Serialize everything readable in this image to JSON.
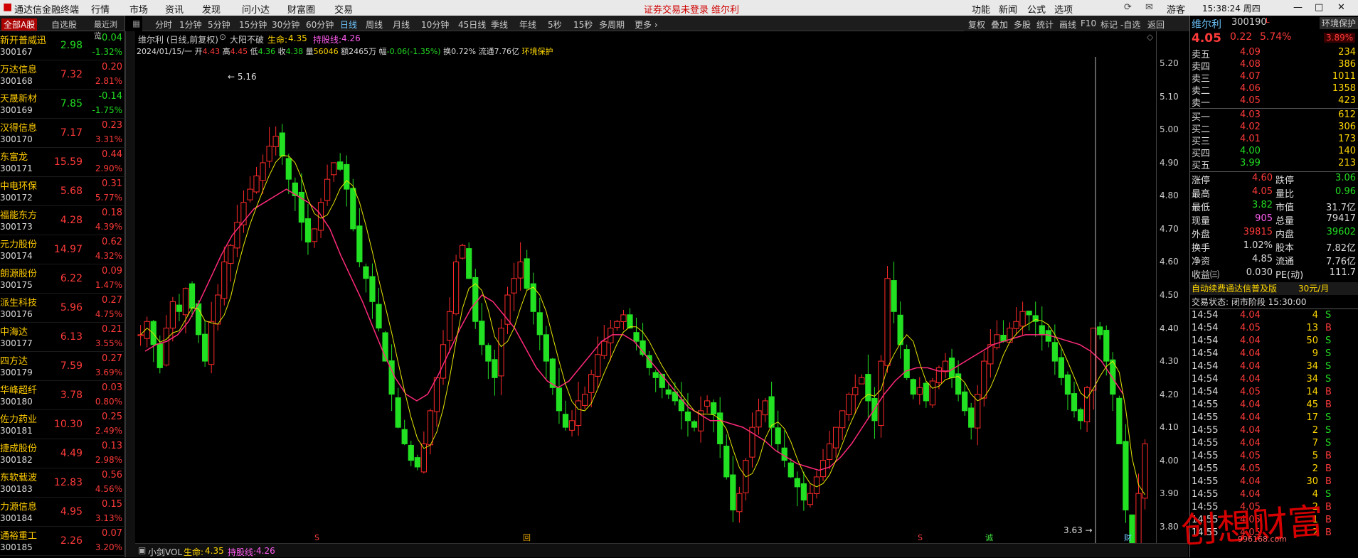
{
  "menu": {
    "app_title": "通达信金融终端",
    "items": [
      "行情",
      "市场",
      "资讯",
      "发现",
      "问小达",
      "财富圈",
      "交易"
    ],
    "login_warning": "证券交易未登录",
    "stock_name": "维尔利",
    "right_items": [
      "功能",
      "新闻",
      "公式",
      "选项"
    ],
    "guest": "游客",
    "clock": "15:38:24 周四"
  },
  "left": {
    "tabs": [
      "全部A股",
      "自选股",
      "最近浏览"
    ],
    "rows": [
      {
        "name": "新开普威迅",
        "code": "300167",
        "price": "2.98",
        "chg": "-0.04",
        "pct": "-1.32%",
        "dir": "dn"
      },
      {
        "name": "万达信息",
        "code": "300168",
        "price": "7.32",
        "chg": "0.20",
        "pct": "2.81%",
        "dir": "up"
      },
      {
        "name": "天晟新材",
        "code": "300169",
        "price": "7.85",
        "chg": "-0.14",
        "pct": "-1.75%",
        "dir": "dn"
      },
      {
        "name": "汉得信息",
        "code": "300170",
        "price": "7.17",
        "chg": "0.23",
        "pct": "3.31%",
        "dir": "up"
      },
      {
        "name": "东富龙",
        "code": "300171",
        "price": "15.59",
        "chg": "0.44",
        "pct": "2.90%",
        "dir": "up"
      },
      {
        "name": "中电环保",
        "code": "300172",
        "price": "5.68",
        "chg": "0.31",
        "pct": "5.77%",
        "dir": "up"
      },
      {
        "name": "福能东方",
        "code": "300173",
        "price": "4.28",
        "chg": "0.18",
        "pct": "4.39%",
        "dir": "up"
      },
      {
        "name": "元力股份",
        "code": "300174",
        "price": "14.97",
        "chg": "0.62",
        "pct": "4.32%",
        "dir": "up"
      },
      {
        "name": "朗源股份",
        "code": "300175",
        "price": "6.22",
        "chg": "0.09",
        "pct": "1.47%",
        "dir": "up"
      },
      {
        "name": "派生科技",
        "code": "300176",
        "price": "5.96",
        "chg": "0.27",
        "pct": "4.75%",
        "dir": "up"
      },
      {
        "name": "中海达",
        "code": "300177",
        "price": "6.13",
        "chg": "0.21",
        "pct": "3.55%",
        "dir": "up"
      },
      {
        "name": "四方达",
        "code": "300179",
        "price": "7.59",
        "chg": "0.27",
        "pct": "3.69%",
        "dir": "up"
      },
      {
        "name": "华峰超纤",
        "code": "300180",
        "price": "3.78",
        "chg": "0.03",
        "pct": "0.80%",
        "dir": "up"
      },
      {
        "name": "佐力药业",
        "code": "300181",
        "price": "10.30",
        "chg": "0.25",
        "pct": "2.49%",
        "dir": "up"
      },
      {
        "name": "捷成股份",
        "code": "300182",
        "price": "4.49",
        "chg": "0.13",
        "pct": "2.98%",
        "dir": "up"
      },
      {
        "name": "东软载波",
        "code": "300183",
        "price": "12.83",
        "chg": "0.56",
        "pct": "4.56%",
        "dir": "up"
      },
      {
        "name": "力源信息",
        "code": "300184",
        "price": "4.95",
        "chg": "0.15",
        "pct": "3.13%",
        "dir": "up"
      },
      {
        "name": "通裕重工",
        "code": "300185",
        "price": "2.26",
        "chg": "0.07",
        "pct": "3.20%",
        "dir": "up"
      }
    ]
  },
  "period": {
    "items": [
      "分时",
      "1分钟",
      "5分钟",
      "15分钟",
      "30分钟",
      "60分钟",
      "日线",
      "周线",
      "月线",
      "10分钟",
      "45日线",
      "季线",
      "年线",
      "5秒",
      "15秒",
      "多周期",
      "更多 ›"
    ],
    "selected": "日线"
  },
  "toolbar": {
    "items": [
      "复权",
      "叠加",
      "多股",
      "统计",
      "画线",
      "F10",
      "标记",
      "-自选",
      "返回"
    ]
  },
  "chart": {
    "title": "维尔利 (日线,前复权)",
    "indicator": "大阳不破",
    "life_label": "生命:",
    "life_value": "4.35",
    "hold_label": "持股线:",
    "hold_value": "4.26",
    "date": "2024/01/15/一",
    "open_l": "开",
    "open": "4.43",
    "high_l": "高",
    "high": "4.45",
    "low_l": "低",
    "low": "4.36",
    "close_l": "收",
    "close": "4.38",
    "vol_l": "量",
    "vol": "56046",
    "amt_l": "额",
    "amt": "2465万",
    "amp_l": "幅",
    "amp": "-0.06(-1.35%)",
    "turn_l": "换",
    "turn": "0.72%",
    "flow_l": "流通",
    "flow": "7.76亿",
    "tag": "环境保护",
    "max_label": "5.16",
    "min_label": "3.63",
    "y_ticks": [
      "5.20",
      "5.10",
      "5.00",
      "4.90",
      "4.80",
      "4.70",
      "4.60",
      "4.50",
      "4.40",
      "4.30",
      "4.20",
      "4.10",
      "4.00",
      "3.90",
      "3.80"
    ],
    "markers": [
      "S",
      "回",
      "S",
      "诚",
      "财"
    ]
  },
  "vol": {
    "name": "小剑VOL",
    "life_label": "生命:",
    "life_value": "4.35",
    "hold_label": "持股线:",
    "hold_value": "4.26"
  },
  "chart_data": {
    "type": "candlestick",
    "title": "维尔利 (日线,前复权)",
    "ylim": [
      3.75,
      5.22
    ],
    "ticks": [
      5.2,
      5.1,
      5.0,
      4.9,
      4.8,
      4.7,
      4.6,
      4.5,
      4.4,
      4.3,
      4.2,
      4.1,
      4.0,
      3.9,
      3.8
    ],
    "max": 5.16,
    "min": 3.63,
    "close_path": [
      4.38,
      4.42,
      4.35,
      4.28,
      4.4,
      4.48,
      4.45,
      4.52,
      4.46,
      4.38,
      4.3,
      4.42,
      4.5,
      4.6,
      4.65,
      4.72,
      4.78,
      4.82,
      4.86,
      4.9,
      4.95,
      4.98,
      4.92,
      4.85,
      4.8,
      4.72,
      4.66,
      4.7,
      4.78,
      4.85,
      4.9,
      4.88,
      4.82,
      4.7,
      4.6,
      4.55,
      4.48,
      4.4,
      4.3,
      4.2,
      4.1,
      4.05,
      4.0,
      3.98,
      4.05,
      4.15,
      4.25,
      4.35,
      4.45,
      4.6,
      4.65,
      4.55,
      4.42,
      4.35,
      4.3,
      4.25,
      4.4,
      4.5,
      4.55,
      4.6,
      4.52,
      4.45,
      4.38,
      4.3,
      4.22,
      4.15,
      4.1,
      4.12,
      4.18,
      4.2,
      4.26,
      4.32,
      4.36,
      4.4,
      4.42,
      4.44,
      4.4,
      4.36,
      4.32,
      4.28,
      4.25,
      4.22,
      4.2,
      4.18,
      4.15,
      4.12,
      4.1,
      4.15,
      4.18,
      4.14,
      4.05,
      3.95,
      3.85,
      3.9,
      4.0,
      4.1,
      4.15,
      4.18,
      4.1,
      4.05,
      4.0,
      3.95,
      3.92,
      3.88,
      3.9,
      3.95,
      4.0,
      4.05,
      4.1,
      4.15,
      4.2,
      4.22,
      4.25,
      4.18,
      4.12,
      4.3,
      4.55,
      4.45,
      4.35,
      4.25,
      4.2,
      4.22,
      4.18,
      4.24,
      4.28,
      4.3,
      4.25,
      4.2,
      4.15,
      4.1,
      4.2,
      4.3,
      4.35,
      4.38,
      4.36,
      4.4,
      4.42,
      4.45,
      4.44,
      4.42,
      4.38,
      4.36,
      4.3,
      4.25,
      4.2,
      4.15,
      4.12,
      4.22,
      4.4,
      4.38,
      4.3,
      4.2,
      4.05,
      3.85,
      3.63,
      3.9,
      4.05
    ],
    "ma_path": [
      4.33,
      4.35,
      4.36,
      4.38,
      4.42,
      4.48,
      4.55,
      4.62,
      4.68,
      4.72,
      4.76,
      4.78,
      4.8,
      4.82,
      4.8,
      4.78,
      4.75,
      4.7,
      4.62,
      4.55,
      4.48,
      4.4,
      4.32,
      4.25,
      4.2,
      4.18,
      4.2,
      4.26,
      4.33,
      4.4,
      4.46,
      4.5,
      4.48,
      4.44,
      4.4,
      4.34,
      4.28,
      4.24,
      4.22,
      4.24,
      4.28,
      4.32,
      4.36,
      4.38,
      4.38,
      4.36,
      4.32,
      4.28,
      4.24,
      4.2,
      4.16,
      4.14,
      4.12,
      4.12,
      4.11,
      4.1,
      4.08,
      4.06,
      4.03,
      4.01,
      3.99,
      3.98,
      3.97,
      3.98,
      4.01,
      4.05,
      4.1,
      4.15,
      4.2,
      4.24,
      4.27,
      4.28,
      4.28,
      4.27,
      4.27,
      4.29,
      4.31,
      4.33,
      4.35,
      4.36,
      4.37,
      4.38,
      4.38,
      4.38,
      4.37,
      4.36,
      4.35,
      4.33,
      4.3,
      4.25,
      4.2
    ]
  },
  "quote": {
    "name": "维尔利",
    "code": "300190",
    "flag": "L",
    "tag": "环境保护",
    "price": "4.05",
    "chg": "0.22",
    "pct": "5.74%",
    "weibi": "3.89%",
    "asks": [
      {
        "l": "卖五",
        "p": "4.09",
        "v": "234"
      },
      {
        "l": "卖四",
        "p": "4.08",
        "v": "386"
      },
      {
        "l": "卖三",
        "p": "4.07",
        "v": "1011"
      },
      {
        "l": "卖二",
        "p": "4.06",
        "v": "1358"
      },
      {
        "l": "卖一",
        "p": "4.05",
        "v": "423"
      }
    ],
    "bids": [
      {
        "l": "买一",
        "p": "4.03",
        "v": "612"
      },
      {
        "l": "买二",
        "p": "4.02",
        "v": "306"
      },
      {
        "l": "买三",
        "p": "4.01",
        "v": "173"
      },
      {
        "l": "买四",
        "p": "4.00",
        "v": "140"
      },
      {
        "l": "买五",
        "p": "3.99",
        "v": "213"
      }
    ],
    "stats": [
      {
        "a": "涨停",
        "b": "4.60",
        "bc": "up",
        "c": "跌停",
        "d": "3.06",
        "dc": "dn"
      },
      {
        "a": "最高",
        "b": "4.05",
        "bc": "up",
        "c": "量比",
        "d": "0.96",
        "dc": "dn"
      },
      {
        "a": "最低",
        "b": "3.82",
        "bc": "dn",
        "c": "市值",
        "d": "31.7亿",
        "dc": "wh"
      },
      {
        "a": "现量",
        "b": "905",
        "bc": "pk",
        "c": "总量",
        "d": "79417",
        "dc": "wh"
      },
      {
        "a": "外盘",
        "b": "39815",
        "bc": "up",
        "c": "内盘",
        "d": "39602",
        "dc": "dn"
      },
      {
        "a": "换手",
        "b": "1.02%",
        "bc": "wh",
        "c": "股本",
        "d": "7.82亿",
        "dc": "wh"
      },
      {
        "a": "净资",
        "b": "4.85",
        "bc": "wh",
        "c": "流通",
        "d": "7.76亿",
        "dc": "wh"
      },
      {
        "a": "收益㈢",
        "b": "0.030",
        "bc": "wh",
        "c": "PE(动)",
        "d": "111.7",
        "dc": "wh"
      }
    ],
    "ad": "自动续费通达信普及版",
    "ad_price": "30元/月",
    "status": "交易状态: 闭市阶段 15:30:00",
    "ticks": [
      {
        "t": "14:54",
        "p": "4.04",
        "v": "4",
        "s": "S"
      },
      {
        "t": "14:54",
        "p": "4.05",
        "v": "13",
        "s": "B"
      },
      {
        "t": "14:54",
        "p": "4.04",
        "v": "50",
        "s": "S"
      },
      {
        "t": "14:54",
        "p": "4.04",
        "v": "9",
        "s": "S"
      },
      {
        "t": "14:54",
        "p": "4.04",
        "v": "34",
        "s": "S"
      },
      {
        "t": "14:54",
        "p": "4.04",
        "v": "34",
        "s": "S"
      },
      {
        "t": "14:54",
        "p": "4.05",
        "v": "14",
        "s": "B"
      },
      {
        "t": "14:55",
        "p": "4.04",
        "v": "45",
        "s": "B"
      },
      {
        "t": "14:55",
        "p": "4.04",
        "v": "17",
        "s": "S"
      },
      {
        "t": "14:55",
        "p": "4.04",
        "v": "2",
        "s": "S"
      },
      {
        "t": "14:55",
        "p": "4.04",
        "v": "7",
        "s": "S"
      },
      {
        "t": "14:55",
        "p": "4.05",
        "v": "5",
        "s": "B"
      },
      {
        "t": "14:55",
        "p": "4.05",
        "v": "2",
        "s": "B"
      },
      {
        "t": "14:55",
        "p": "4.04",
        "v": "30",
        "s": "B"
      },
      {
        "t": "14:55",
        "p": "4.04",
        "v": "4",
        "s": "S"
      },
      {
        "t": "14:55",
        "p": "4.05",
        "v": "2",
        "s": "B"
      },
      {
        "t": "14:55",
        "p": "4.05",
        "v": "1",
        "s": "B"
      },
      {
        "t": "14:55",
        "p": "4.05",
        "v": "2",
        "s": "B"
      }
    ]
  },
  "watermark": {
    "text": "创想财富",
    "url": "996168.com"
  }
}
